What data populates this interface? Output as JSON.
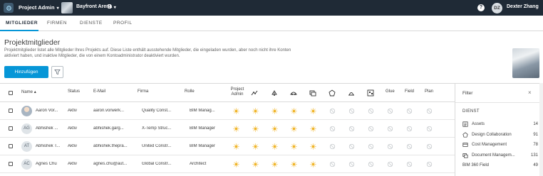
{
  "topbar": {
    "app_title": "Project Admin",
    "project_name": "Bayfront Arena",
    "project_badge": "B",
    "help": "?",
    "user_initials": "DZ",
    "user_name": "Dexter Zhang"
  },
  "tabs": [
    "MITGLIEDER",
    "FIRMEN",
    "DIENSTE",
    "PROFIL"
  ],
  "page": {
    "title": "Projektmitglieder",
    "description": "Projektmitglieder listet alle Mitglieder Ihres Projekts auf. Diese Liste enthält ausstehende Mitglieder, die eingeladen wurden, aber noch nicht ihre Konten aktiviert haben, und inaktive Mitglieder, die von einem Kontoadministrator deaktiviert wurden.",
    "add_button": "Hinzufügen"
  },
  "table": {
    "columns": {
      "name": "Name",
      "status": "Status",
      "email": "E-Mail",
      "company": "Firma",
      "role": "Rolle",
      "project_admin": "Project Admin",
      "glue": "Glue",
      "field": "Field",
      "plan": "Plan"
    },
    "service_icons": [
      "insight-icon",
      "design-collab-icon",
      "cost-icon",
      "document-icon",
      "model-coord-icon",
      "build-icon",
      "qr-icon"
    ],
    "rows": [
      {
        "avatar": "",
        "avatar_photo": true,
        "name": "Aaron Vor...",
        "status": "Aktiv",
        "email": "aaron.vorwerk...",
        "company": "Quality Const...",
        "role": "BIM Manag..."
      },
      {
        "avatar": "AG",
        "avatar_photo": false,
        "name": "Abhishek ...",
        "status": "Aktiv",
        "email": "abhishek.garg...",
        "company": "X-Temp Struc...",
        "role": "BIM Manager"
      },
      {
        "avatar": "AT",
        "avatar_photo": false,
        "name": "Abhishek T...",
        "status": "Aktiv",
        "email": "abhishek.thepra...",
        "company": "United Constr...",
        "role": "BIM Manager"
      },
      {
        "avatar": "AC",
        "avatar_photo": false,
        "name": "Agnes Chu",
        "status": "Aktiv",
        "email": "agnes.chu@aut...",
        "company": "Global Constr...",
        "role": "Architect"
      }
    ]
  },
  "filter": {
    "title": "Filter",
    "close": "×",
    "section": "DIENST",
    "items": [
      {
        "label": "Assets",
        "count": "14",
        "icon": "assets-icon"
      },
      {
        "label": "Design Collaboration",
        "count": "91",
        "icon": "design-collab-icon"
      },
      {
        "label": "Cost Management",
        "count": "78",
        "icon": "cost-icon"
      },
      {
        "label": "Document Managem...",
        "count": "131",
        "icon": "document-icon"
      },
      {
        "label": "BIM 360 Field",
        "count": "49",
        "icon": ""
      }
    ]
  },
  "colors": {
    "topbar": "#1f2a36",
    "accent": "#0696d7",
    "admin_sun": "#f0b52a",
    "disabled": "#c5c9cc"
  }
}
